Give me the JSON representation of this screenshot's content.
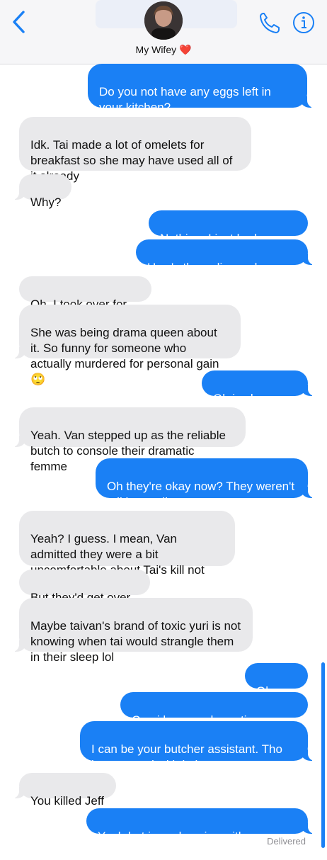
{
  "header": {
    "contact_name": "My Wifey",
    "heart": "❤️",
    "icons": {
      "back": "chevron-left-icon",
      "phone": "phone-icon",
      "info": "info-icon"
    },
    "accent_color": "#1a80f5"
  },
  "messages": [
    {
      "side": "out",
      "text": "Do you not have any eggs left in your kitchen?"
    },
    {
      "side": "in",
      "text": "Idk. Tai made a lot of omelets for breakfast so she may have used all of it already"
    },
    {
      "side": "in",
      "text": "Why?"
    },
    {
      "side": "out",
      "text": "Nothing. I just had an idea"
    },
    {
      "side": "out",
      "text": "How's the... disposal going?"
    },
    {
      "side": "in",
      "text": "Oh. I took over for Tai"
    },
    {
      "side": "in",
      "text": "She was being drama queen about it. So funny for someone who actually murdered for personal gain 🙄"
    },
    {
      "side": "out",
      "text": "Oh is she okay?"
    },
    {
      "side": "in",
      "text": "Yeah. Van stepped up as the reliable butch to console their dramatic femme"
    },
    {
      "side": "out",
      "text": "Oh they're okay now? They weren't talking earlier"
    },
    {
      "side": "in",
      "text": "Yeah? I guess. I mean, Van admitted they were a bit uncomfortable about Tai's kill not being \"love motivated\""
    },
    {
      "side": "in",
      "text": "But they'd get over it"
    },
    {
      "side": "in",
      "text": "Maybe taivan's brand of toxic yuri is not knowing when tai would strangle them in their sleep lol"
    },
    {
      "side": "out",
      "text": "Oh nice"
    },
    {
      "side": "out",
      "text": "Can i be your dramatic femme?"
    },
    {
      "side": "out",
      "text": "I can be your butcher assistant. Tho im not good with knives"
    },
    {
      "side": "in",
      "text": "You killed Jeff"
    },
    {
      "side": "out",
      "text": "Yeah but i was buzzing with emotions"
    }
  ],
  "status": "Delivered"
}
